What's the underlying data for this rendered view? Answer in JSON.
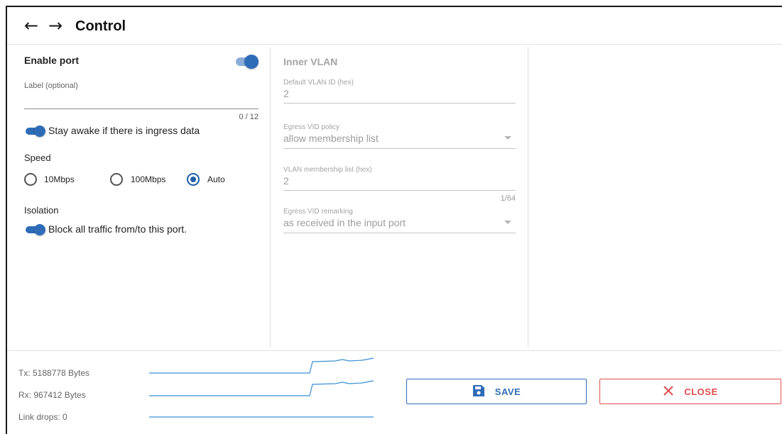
{
  "header": {
    "back_icon": "arrow-left-icon",
    "forward_icon": "arrow-right-icon",
    "title": "Control"
  },
  "left": {
    "enable_port_label": "Enable port",
    "enable_port_on": true,
    "label_field": {
      "label": "Label (optional)",
      "value": "",
      "counter": "0 / 12"
    },
    "stay_awake": {
      "label": "Stay awake if there is ingress data",
      "on": true
    },
    "speed": {
      "heading": "Speed",
      "options": [
        "10Mbps",
        "100Mbps",
        "Auto"
      ],
      "selected": "Auto"
    },
    "isolation": {
      "heading": "Isolation",
      "block_label": "Block all traffic from/to this port.",
      "on": true
    }
  },
  "inner_vlan": {
    "heading": "Inner VLAN",
    "default_vlan": {
      "label": "Default VLAN ID (hex)",
      "value": "2"
    },
    "egress_vid_policy": {
      "label": "Egress VID policy",
      "value": "allow membership list"
    },
    "membership_list": {
      "label": "VLAN membership list (hex)",
      "value": "2",
      "counter": "1/64"
    },
    "egress_vid_remarking": {
      "label": "Egress VID remarking",
      "value": "as received in the input port"
    }
  },
  "stats": {
    "tx": "Tx: 5188778 Bytes",
    "rx": "Rx: 967412 Bytes",
    "link_drops": "Link drops: 0"
  },
  "buttons": {
    "save": "SAVE",
    "close": "CLOSE",
    "save_icon": "floppy-disk-icon",
    "close_icon": "close-x-icon"
  },
  "colors": {
    "primary": "#2f6cb8",
    "danger": "#e24c4c",
    "sparkline": "#3a8fd6"
  }
}
